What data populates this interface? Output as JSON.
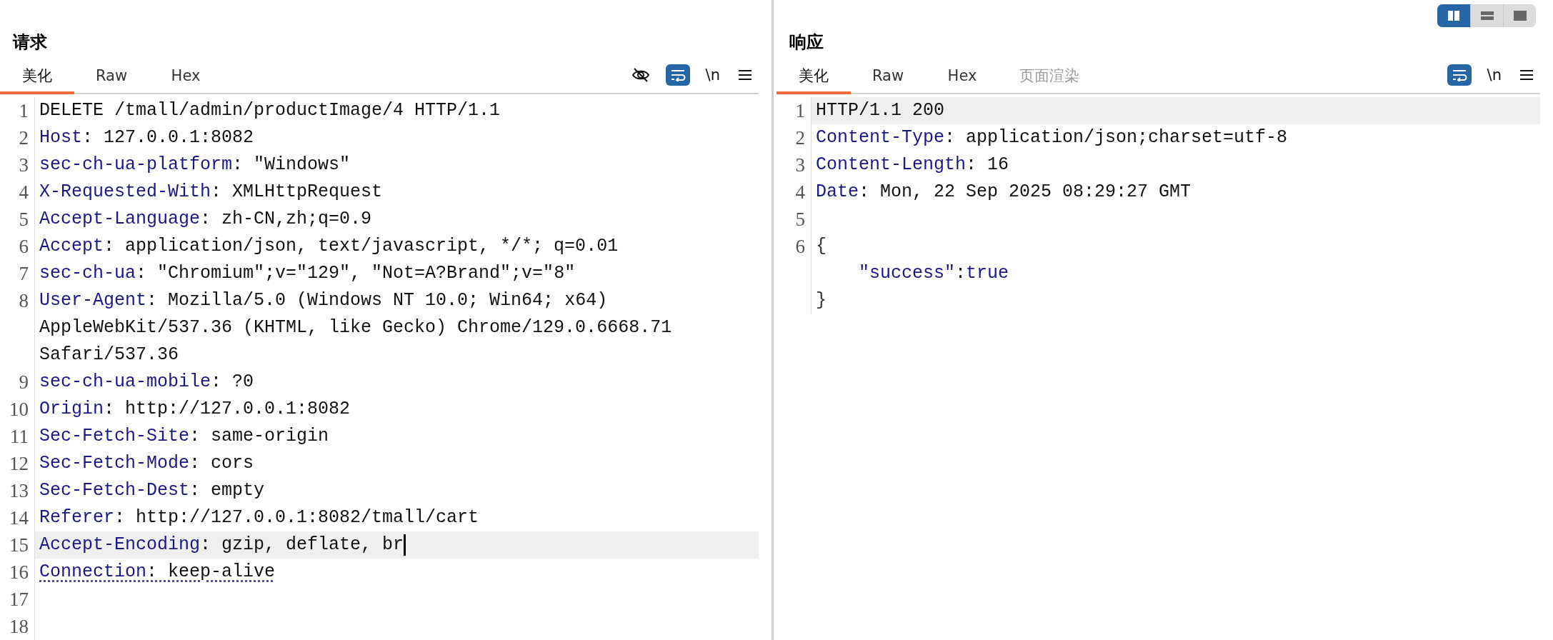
{
  "layout_toggle": [
    {
      "kind": "columns",
      "selected": true
    },
    {
      "kind": "rows",
      "selected": false
    },
    {
      "kind": "single",
      "selected": false
    }
  ],
  "panes": [
    {
      "title": "请求",
      "tabs": [
        {
          "label": "美化",
          "selected": true,
          "disabled": false
        },
        {
          "label": "Raw",
          "selected": false,
          "disabled": false
        },
        {
          "label": "Hex",
          "selected": false,
          "disabled": false
        }
      ],
      "tools": [
        {
          "kind": "hide"
        },
        {
          "kind": "wrap",
          "on": true
        },
        {
          "kind": "newline",
          "label": "\\n"
        },
        {
          "kind": "menu"
        }
      ],
      "lines": [
        {
          "number": "1",
          "current": false,
          "rows": [
            {
              "kind": "plain",
              "segments": [
                {
                  "text": "DELETE /tmall/admin/productImage/4 HTTP/1.1",
                  "kind": "value"
                }
              ]
            }
          ]
        },
        {
          "number": "2",
          "current": false,
          "rows": [
            {
              "kind": "plain",
              "segments": [
                {
                  "text": "Host",
                  "kind": "name"
                },
                {
                  "text": ": 127.0.0.1:8082",
                  "kind": "value"
                }
              ]
            }
          ]
        },
        {
          "number": "3",
          "current": false,
          "rows": [
            {
              "kind": "plain",
              "segments": [
                {
                  "text": "sec-ch-ua-platform",
                  "kind": "name"
                },
                {
                  "text": ": \"Windows\"",
                  "kind": "value"
                }
              ]
            }
          ]
        },
        {
          "number": "4",
          "current": false,
          "rows": [
            {
              "kind": "plain",
              "segments": [
                {
                  "text": "X-Requested-With",
                  "kind": "name"
                },
                {
                  "text": ": XMLHttpRequest",
                  "kind": "value"
                }
              ]
            }
          ]
        },
        {
          "number": "5",
          "current": false,
          "rows": [
            {
              "kind": "plain",
              "segments": [
                {
                  "text": "Accept-Language",
                  "kind": "name"
                },
                {
                  "text": ": zh-CN,zh;q=0.9",
                  "kind": "value"
                }
              ]
            }
          ]
        },
        {
          "number": "6",
          "current": false,
          "rows": [
            {
              "kind": "plain",
              "segments": [
                {
                  "text": "Accept",
                  "kind": "name"
                },
                {
                  "text": ": application/json, text/javascript, */*; q=0.01",
                  "kind": "value"
                }
              ]
            }
          ]
        },
        {
          "number": "7",
          "current": false,
          "rows": [
            {
              "kind": "plain",
              "segments": [
                {
                  "text": "sec-ch-ua",
                  "kind": "name"
                },
                {
                  "text": ": \"Chromium\";v=\"129\", \"Not=A?Brand\";v=\"8\"",
                  "kind": "value"
                }
              ]
            }
          ]
        },
        {
          "number": "8",
          "current": false,
          "rows": [
            {
              "kind": "plain",
              "segments": [
                {
                  "text": "User-Agent",
                  "kind": "name"
                },
                {
                  "text": ": Mozilla/5.0 (Windows NT 10.0; Win64; x64) AppleWebKit/537.36 (KHTML, like Gecko) Chrome/129.0.6668.71 Safari/537.36",
                  "kind": "value"
                }
              ]
            }
          ]
        },
        {
          "number": "9",
          "current": false,
          "rows": [
            {
              "kind": "plain",
              "segments": [
                {
                  "text": "sec-ch-ua-mobile",
                  "kind": "name"
                },
                {
                  "text": ": ?0",
                  "kind": "value"
                }
              ]
            }
          ]
        },
        {
          "number": "10",
          "current": false,
          "rows": [
            {
              "kind": "plain",
              "segments": [
                {
                  "text": "Origin",
                  "kind": "name"
                },
                {
                  "text": ": http://127.0.0.1:8082",
                  "kind": "value"
                }
              ]
            }
          ]
        },
        {
          "number": "11",
          "current": false,
          "rows": [
            {
              "kind": "plain",
              "segments": [
                {
                  "text": "Sec-Fetch-Site",
                  "kind": "name"
                },
                {
                  "text": ": same-origin",
                  "kind": "value"
                }
              ]
            }
          ]
        },
        {
          "number": "12",
          "current": false,
          "rows": [
            {
              "kind": "plain",
              "segments": [
                {
                  "text": "Sec-Fetch-Mode",
                  "kind": "name"
                },
                {
                  "text": ": cors",
                  "kind": "value"
                }
              ]
            }
          ]
        },
        {
          "number": "13",
          "current": false,
          "rows": [
            {
              "kind": "plain",
              "segments": [
                {
                  "text": "Sec-Fetch-Dest",
                  "kind": "name"
                },
                {
                  "text": ": empty",
                  "kind": "value"
                }
              ]
            }
          ]
        },
        {
          "number": "14",
          "current": false,
          "rows": [
            {
              "kind": "plain",
              "segments": [
                {
                  "text": "Referer",
                  "kind": "name"
                },
                {
                  "text": ": http://127.0.0.1:8082/tmall/cart",
                  "kind": "value"
                }
              ]
            }
          ]
        },
        {
          "number": "15",
          "current": true,
          "cursor": true,
          "rows": [
            {
              "kind": "plain",
              "segments": [
                {
                  "text": "Accept-Encoding",
                  "kind": "name"
                },
                {
                  "text": ": gzip, deflate, br",
                  "kind": "value"
                }
              ]
            }
          ]
        },
        {
          "number": "16",
          "current": false,
          "underlined": true,
          "rows": [
            {
              "kind": "plain",
              "segments": [
                {
                  "text": "Connection",
                  "kind": "name"
                },
                {
                  "text": ": keep-alive",
                  "kind": "value"
                }
              ]
            }
          ]
        },
        {
          "number": "17",
          "current": false,
          "rows": [
            {
              "kind": "plain",
              "segments": []
            }
          ]
        },
        {
          "number": "18",
          "current": false,
          "rows": [
            {
              "kind": "plain",
              "segments": []
            }
          ]
        }
      ]
    },
    {
      "title": "响应",
      "tabs": [
        {
          "label": "美化",
          "selected": true,
          "disabled": false
        },
        {
          "label": "Raw",
          "selected": false,
          "disabled": false
        },
        {
          "label": "Hex",
          "selected": false,
          "disabled": false
        },
        {
          "label": "页面渲染",
          "selected": false,
          "disabled": true
        }
      ],
      "tools": [
        {
          "kind": "wrap",
          "on": true
        },
        {
          "kind": "newline",
          "label": "\\n"
        },
        {
          "kind": "menu"
        }
      ],
      "lines": [
        {
          "number": "1",
          "current": true,
          "rows": [
            {
              "kind": "plain",
              "segments": [
                {
                  "text": "HTTP/1.1 200",
                  "kind": "value"
                }
              ]
            }
          ]
        },
        {
          "number": "2",
          "current": false,
          "rows": [
            {
              "kind": "plain",
              "segments": [
                {
                  "text": "Content-Type",
                  "kind": "name"
                },
                {
                  "text": ": application/json;charset=utf-8",
                  "kind": "value"
                }
              ]
            }
          ]
        },
        {
          "number": "3",
          "current": false,
          "rows": [
            {
              "kind": "plain",
              "segments": [
                {
                  "text": "Content-Length",
                  "kind": "name"
                },
                {
                  "text": ": 16",
                  "kind": "value"
                }
              ]
            }
          ]
        },
        {
          "number": "4",
          "current": false,
          "rows": [
            {
              "kind": "plain",
              "segments": [
                {
                  "text": "Date",
                  "kind": "name"
                },
                {
                  "text": ": Mon, 22 Sep 2025 08:29:27 GMT",
                  "kind": "value"
                }
              ]
            }
          ]
        },
        {
          "number": "5",
          "current": false,
          "rows": [
            {
              "kind": "plain",
              "segments": []
            }
          ]
        },
        {
          "number": "6",
          "current": false,
          "rows": [
            {
              "kind": "plain",
              "segments": [
                {
                  "text": "{",
                  "kind": "punct"
                }
              ]
            },
            {
              "kind": "indented",
              "segments": [
                {
                  "text": "\"success\"",
                  "kind": "name"
                },
                {
                  "text": ":",
                  "kind": "value"
                },
                {
                  "text": "true",
                  "kind": "name"
                }
              ]
            },
            {
              "kind": "plain",
              "segments": [
                {
                  "text": "}",
                  "kind": "punct"
                }
              ]
            }
          ]
        }
      ]
    }
  ]
}
